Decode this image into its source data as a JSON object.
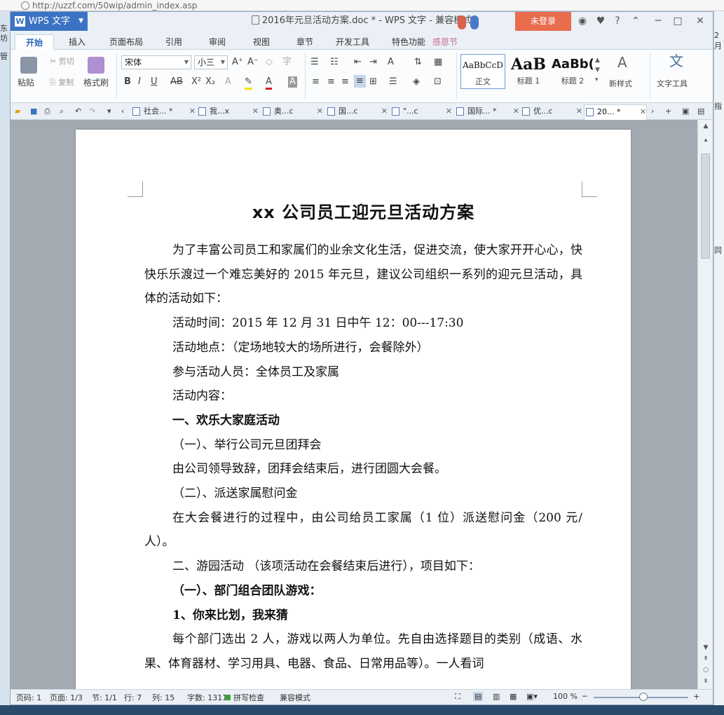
{
  "browser": {
    "url": "http://uzzf.com/50wip/admin_index.asp"
  },
  "left_strip": {
    "t1": "东坊",
    "t2": "管"
  },
  "right_strip": {
    "t1": "2月",
    "t2": "指",
    "t3": "同"
  },
  "app": {
    "menu_label": "WPS 文字",
    "title": "2016年元旦活动方案.doc * - WPS 文字 - 兼容模式",
    "login": "未登录"
  },
  "tabs": [
    "开始",
    "插入",
    "页面布局",
    "引用",
    "审阅",
    "视图",
    "章节",
    "开发工具",
    "特色功能"
  ],
  "tab_extra": "感恩节",
  "ribbon": {
    "paste": "粘贴",
    "cut": "剪切",
    "copy": "复制",
    "format_painter": "格式刷",
    "font_name": "宋体",
    "font_size": "小三",
    "styles": [
      {
        "sample": "AaBbCcD",
        "label": "正文"
      },
      {
        "sample": "AaB",
        "label": "标题 1"
      },
      {
        "sample": "AaBb(",
        "label": "标题 2"
      }
    ],
    "new_style": "新样式",
    "text_tools": "文字工具"
  },
  "doc_tabs": [
    {
      "label": "社会... *"
    },
    {
      "label": "我...x"
    },
    {
      "label": "奥...c"
    },
    {
      "label": "国...c"
    },
    {
      "label": "\"...c"
    },
    {
      "label": "国际... *"
    },
    {
      "label": "优...c"
    },
    {
      "label": "20... *",
      "active": true
    }
  ],
  "document": {
    "title": "xx 公司员工迎元旦活动方案",
    "paragraphs": [
      {
        "text": "为了丰富公司员工和家属们的业余文化生活，促进交流，使大家开开心心，快快乐乐渡过一个难忘美好的 2015 年元旦，建议公司组织一系列的迎元旦活动，具体的活动如下：",
        "style": "ind"
      },
      {
        "text": "活动时间：2015 年 12 月 31 日中午 12：00---17:30",
        "style": "ind"
      },
      {
        "text": "活动地点：（定场地较大的场所进行，会餐除外）",
        "style": "ind"
      },
      {
        "text": "参与活动人员：全体员工及家属",
        "style": "ind"
      },
      {
        "text": "活动内容：",
        "style": "ind"
      },
      {
        "text": "一、欢乐大家庭活动",
        "style": "ind b"
      },
      {
        "text": "（一）、举行公司元旦团拜会",
        "style": "ind1"
      },
      {
        "text": "由公司领导致辞，团拜会结束后，进行团圆大会餐。",
        "style": "ind"
      },
      {
        "text": "（二）、派送家属慰问金",
        "style": "ind1"
      },
      {
        "text": "在大会餐进行的过程中，由公司给员工家属（1 位）派送慰问金（200 元/人）。",
        "style": "ind"
      },
      {
        "text": "二、游园活动 （该项活动在会餐结束后进行），项目如下：",
        "style": "ind"
      },
      {
        "text": "（一）、部门组合团队游戏：",
        "style": "ind1 b"
      },
      {
        "text": "1、你来比划，我来猜",
        "style": "ind b"
      },
      {
        "text": "每个部门选出 2 人，游戏以两人为单位。先自由选择题目的类别（成语、水果、体育器材、学习用具、电器、食品、日常用品等）。一人看词",
        "style": "ind"
      }
    ]
  },
  "status": {
    "page": "页码: 1",
    "pages": "页面: 1/3",
    "section": "节: 1/1",
    "row": "行: 7",
    "col": "列: 15",
    "words": "字数: 1311",
    "spell": "拼写检查",
    "compat": "兼容模式",
    "zoom": "100 %"
  }
}
